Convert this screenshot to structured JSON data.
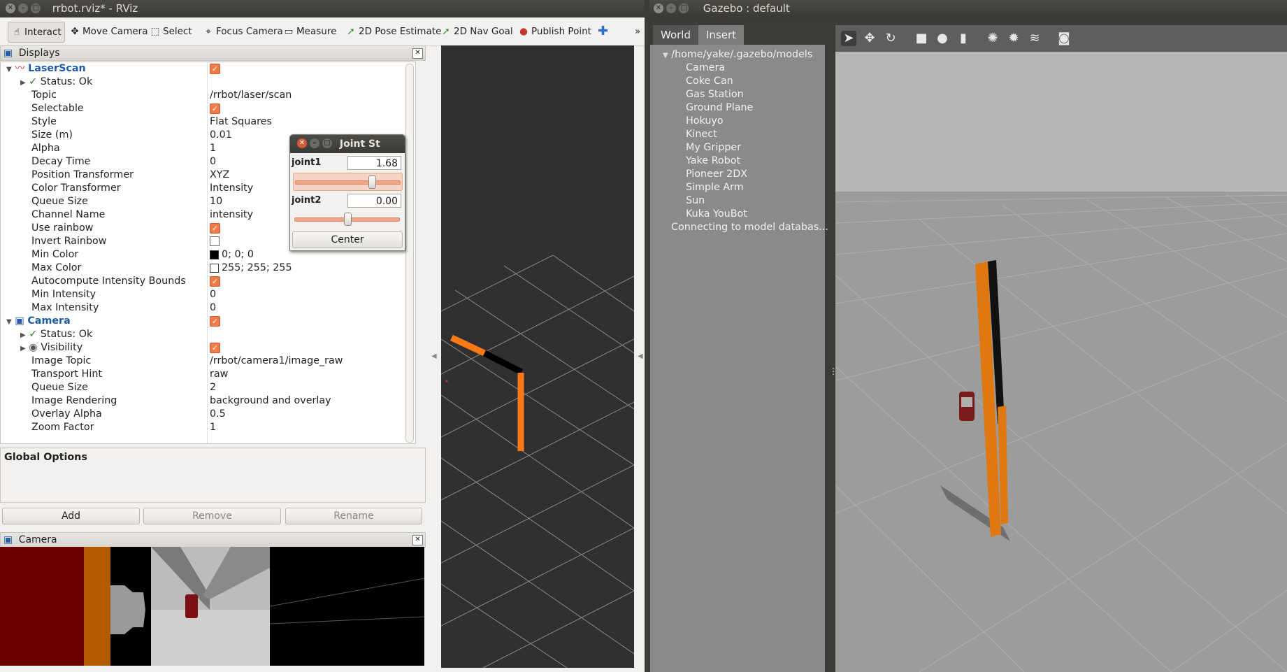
{
  "rviz": {
    "title": "rrbot.rviz* - RViz",
    "toolbar": {
      "interact": "Interact",
      "move_camera": "Move Camera",
      "select": "Select",
      "focus_camera": "Focus Camera",
      "measure": "Measure",
      "pose_estimate": "2D Pose Estimate",
      "nav_goal": "2D Nav Goal",
      "publish_point": "Publish Point",
      "overflow": "»"
    },
    "displays_header": "Displays",
    "laserscan": {
      "name": "LaserScan",
      "status": "Status: Ok",
      "props": [
        {
          "key": "Topic",
          "value": "/rrbot/laser/scan"
        },
        {
          "key": "Selectable",
          "value": ""
        },
        {
          "key": "Style",
          "value": "Flat Squares"
        },
        {
          "key": "Size (m)",
          "value": "0.01"
        },
        {
          "key": "Alpha",
          "value": "1"
        },
        {
          "key": "Decay Time",
          "value": "0"
        },
        {
          "key": "Position Transformer",
          "value": "XYZ"
        },
        {
          "key": "Color Transformer",
          "value": "Intensity"
        },
        {
          "key": "Queue Size",
          "value": "10"
        },
        {
          "key": "Channel Name",
          "value": "intensity"
        },
        {
          "key": "Use rainbow",
          "value": ""
        },
        {
          "key": "Invert Rainbow",
          "value": ""
        },
        {
          "key": "Min Color",
          "value": "0; 0; 0"
        },
        {
          "key": "Max Color",
          "value": "255; 255; 255"
        },
        {
          "key": "Autocompute Intensity Bounds",
          "value": ""
        },
        {
          "key": "Min Intensity",
          "value": "0"
        },
        {
          "key": "Max Intensity",
          "value": "0"
        }
      ]
    },
    "camera": {
      "name": "Camera",
      "status": "Status: Ok",
      "visibility": "Visibility",
      "props": [
        {
          "key": "Image Topic",
          "value": "/rrbot/camera1/image_raw"
        },
        {
          "key": "Transport Hint",
          "value": "raw"
        },
        {
          "key": "Queue Size",
          "value": "2"
        },
        {
          "key": "Image Rendering",
          "value": "background and overlay"
        },
        {
          "key": "Overlay Alpha",
          "value": "0.5"
        },
        {
          "key": "Zoom Factor",
          "value": "1"
        }
      ]
    },
    "global_options": "Global Options",
    "buttons": {
      "add": "Add",
      "remove": "Remove",
      "rename": "Rename"
    },
    "camera_panel": "Camera"
  },
  "joint_state": {
    "title": "Joint St",
    "joints": [
      {
        "name": "joint1",
        "value": "1.68",
        "fraction": 0.73
      },
      {
        "name": "joint2",
        "value": "0.00",
        "fraction": 0.5
      }
    ],
    "center": "Center"
  },
  "gazebo": {
    "title": "Gazebo : default",
    "tabs": [
      "World",
      "Insert"
    ],
    "path": "/home/yake/.gazebo/models",
    "models": [
      "Camera",
      "Coke Can",
      "Gas Station",
      "Ground Plane",
      "Hokuyo",
      "Kinect",
      "My Gripper",
      "Yake Robot",
      "Pioneer 2DX",
      "Simple Arm",
      "Sun",
      "Kuka YouBot"
    ],
    "status": "Connecting to model databas..."
  },
  "colors": {
    "robot_orange": "#ff7a14",
    "check_orange": "#f07c4a",
    "link_blue": "#1f5ba6"
  }
}
